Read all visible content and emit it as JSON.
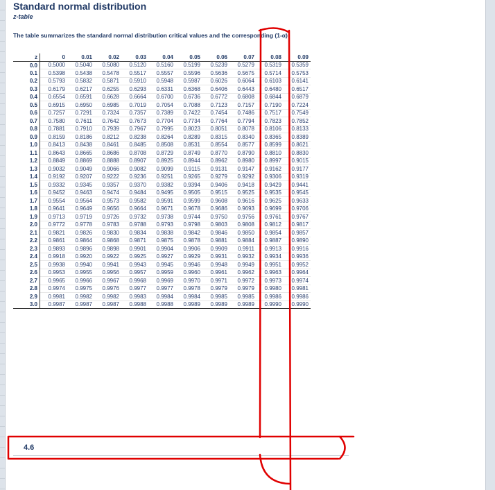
{
  "title": "Standard normal distribution",
  "subtitle": "z-table",
  "description": "The table summarizes the standard normal distribution critical values and the corresponding (1-α)",
  "table": {
    "corner_label": "z",
    "columns": [
      "0",
      "0.01",
      "0.02",
      "0.03",
      "0.04",
      "0.05",
      "0.06",
      "0.07",
      "0.08",
      "0.09"
    ],
    "rows": [
      {
        "z": "0.0",
        "values": [
          "0.5000",
          "0.5040",
          "0.5080",
          "0.5120",
          "0.5160",
          "0.5199",
          "0.5239",
          "0.5279",
          "0.5319",
          "0.5359"
        ]
      },
      {
        "z": "0.1",
        "values": [
          "0.5398",
          "0.5438",
          "0.5478",
          "0.5517",
          "0.5557",
          "0.5596",
          "0.5636",
          "0.5675",
          "0.5714",
          "0.5753"
        ]
      },
      {
        "z": "0.2",
        "values": [
          "0.5793",
          "0.5832",
          "0.5871",
          "0.5910",
          "0.5948",
          "0.5987",
          "0.6026",
          "0.6064",
          "0.6103",
          "0.6141"
        ]
      },
      {
        "z": "0.3",
        "values": [
          "0.6179",
          "0.6217",
          "0.6255",
          "0.6293",
          "0.6331",
          "0.6368",
          "0.6406",
          "0.6443",
          "0.6480",
          "0.6517"
        ]
      },
      {
        "z": "0.4",
        "values": [
          "0.6554",
          "0.6591",
          "0.6628",
          "0.6664",
          "0.6700",
          "0.6736",
          "0.6772",
          "0.6808",
          "0.6844",
          "0.6879"
        ]
      },
      {
        "z": "0.5",
        "values": [
          "0.6915",
          "0.6950",
          "0.6985",
          "0.7019",
          "0.7054",
          "0.7088",
          "0.7123",
          "0.7157",
          "0.7190",
          "0.7224"
        ]
      },
      {
        "z": "0.6",
        "values": [
          "0.7257",
          "0.7291",
          "0.7324",
          "0.7357",
          "0.7389",
          "0.7422",
          "0.7454",
          "0.7486",
          "0.7517",
          "0.7549"
        ]
      },
      {
        "z": "0.7",
        "values": [
          "0.7580",
          "0.7611",
          "0.7642",
          "0.7673",
          "0.7704",
          "0.7734",
          "0.7764",
          "0.7794",
          "0.7823",
          "0.7852"
        ]
      },
      {
        "z": "0.8",
        "values": [
          "0.7881",
          "0.7910",
          "0.7939",
          "0.7967",
          "0.7995",
          "0.8023",
          "0.8051",
          "0.8078",
          "0.8106",
          "0.8133"
        ]
      },
      {
        "z": "0.9",
        "values": [
          "0.8159",
          "0.8186",
          "0.8212",
          "0.8238",
          "0.8264",
          "0.8289",
          "0.8315",
          "0.8340",
          "0.8365",
          "0.8389"
        ]
      },
      {
        "z": "1.0",
        "values": [
          "0.8413",
          "0.8438",
          "0.8461",
          "0.8485",
          "0.8508",
          "0.8531",
          "0.8554",
          "0.8577",
          "0.8599",
          "0.8621"
        ]
      },
      {
        "z": "1.1",
        "values": [
          "0.8643",
          "0.8665",
          "0.8686",
          "0.8708",
          "0.8729",
          "0.8749",
          "0.8770",
          "0.8790",
          "0.8810",
          "0.8830"
        ]
      },
      {
        "z": "1.2",
        "values": [
          "0.8849",
          "0.8869",
          "0.8888",
          "0.8907",
          "0.8925",
          "0.8944",
          "0.8962",
          "0.8980",
          "0.8997",
          "0.9015"
        ]
      },
      {
        "z": "1.3",
        "values": [
          "0.9032",
          "0.9049",
          "0.9066",
          "0.9082",
          "0.9099",
          "0.9115",
          "0.9131",
          "0.9147",
          "0.9162",
          "0.9177"
        ]
      },
      {
        "z": "1.4",
        "values": [
          "0.9192",
          "0.9207",
          "0.9222",
          "0.9236",
          "0.9251",
          "0.9265",
          "0.9279",
          "0.9292",
          "0.9306",
          "0.9319"
        ]
      },
      {
        "z": "1.5",
        "values": [
          "0.9332",
          "0.9345",
          "0.9357",
          "0.9370",
          "0.9382",
          "0.9394",
          "0.9406",
          "0.9418",
          "0.9429",
          "0.9441"
        ]
      },
      {
        "z": "1.6",
        "values": [
          "0.9452",
          "0.9463",
          "0.9474",
          "0.9484",
          "0.9495",
          "0.9505",
          "0.9515",
          "0.9525",
          "0.9535",
          "0.9545"
        ]
      },
      {
        "z": "1.7",
        "values": [
          "0.9554",
          "0.9564",
          "0.9573",
          "0.9582",
          "0.9591",
          "0.9599",
          "0.9608",
          "0.9616",
          "0.9625",
          "0.9633"
        ]
      },
      {
        "z": "1.8",
        "values": [
          "0.9641",
          "0.9649",
          "0.9656",
          "0.9664",
          "0.9671",
          "0.9678",
          "0.9686",
          "0.9693",
          "0.9699",
          "0.9706"
        ]
      },
      {
        "z": "1.9",
        "values": [
          "0.9713",
          "0.9719",
          "0.9726",
          "0.9732",
          "0.9738",
          "0.9744",
          "0.9750",
          "0.9756",
          "0.9761",
          "0.9767"
        ]
      },
      {
        "z": "2.0",
        "values": [
          "0.9772",
          "0.9778",
          "0.9783",
          "0.9788",
          "0.9793",
          "0.9798",
          "0.9803",
          "0.9808",
          "0.9812",
          "0.9817"
        ]
      },
      {
        "z": "2.1",
        "values": [
          "0.9821",
          "0.9826",
          "0.9830",
          "0.9834",
          "0.9838",
          "0.9842",
          "0.9846",
          "0.9850",
          "0.9854",
          "0.9857"
        ]
      },
      {
        "z": "2.2",
        "values": [
          "0.9861",
          "0.9864",
          "0.9868",
          "0.9871",
          "0.9875",
          "0.9878",
          "0.9881",
          "0.9884",
          "0.9887",
          "0.9890"
        ]
      },
      {
        "z": "2.3",
        "values": [
          "0.9893",
          "0.9896",
          "0.9898",
          "0.9901",
          "0.9904",
          "0.9906",
          "0.9909",
          "0.9911",
          "0.9913",
          "0.9916"
        ]
      },
      {
        "z": "2.4",
        "values": [
          "0.9918",
          "0.9920",
          "0.9922",
          "0.9925",
          "0.9927",
          "0.9929",
          "0.9931",
          "0.9932",
          "0.9934",
          "0.9936"
        ]
      },
      {
        "z": "2.5",
        "values": [
          "0.9938",
          "0.9940",
          "0.9941",
          "0.9943",
          "0.9945",
          "0.9946",
          "0.9948",
          "0.9949",
          "0.9951",
          "0.9952"
        ]
      },
      {
        "z": "2.6",
        "values": [
          "0.9953",
          "0.9955",
          "0.9956",
          "0.9957",
          "0.9959",
          "0.9960",
          "0.9961",
          "0.9962",
          "0.9963",
          "0.9964"
        ]
      },
      {
        "z": "2.7",
        "values": [
          "0.9965",
          "0.9966",
          "0.9967",
          "0.9968",
          "0.9969",
          "0.9970",
          "0.9971",
          "0.9972",
          "0.9973",
          "0.9974"
        ]
      },
      {
        "z": "2.8",
        "values": [
          "0.9974",
          "0.9975",
          "0.9976",
          "0.9977",
          "0.9977",
          "0.9978",
          "0.9979",
          "0.9979",
          "0.9980",
          "0.9981"
        ]
      },
      {
        "z": "2.9",
        "values": [
          "0.9981",
          "0.9982",
          "0.9982",
          "0.9983",
          "0.9984",
          "0.9984",
          "0.9985",
          "0.9985",
          "0.9986",
          "0.9986"
        ]
      },
      {
        "z": "3.0",
        "values": [
          "0.9987",
          "0.9987",
          "0.9987",
          "0.9988",
          "0.9988",
          "0.9989",
          "0.9989",
          "0.9989",
          "0.9990",
          "0.9990"
        ]
      }
    ]
  },
  "input_cell_value": "4.6",
  "annotation_color": "#e00000"
}
